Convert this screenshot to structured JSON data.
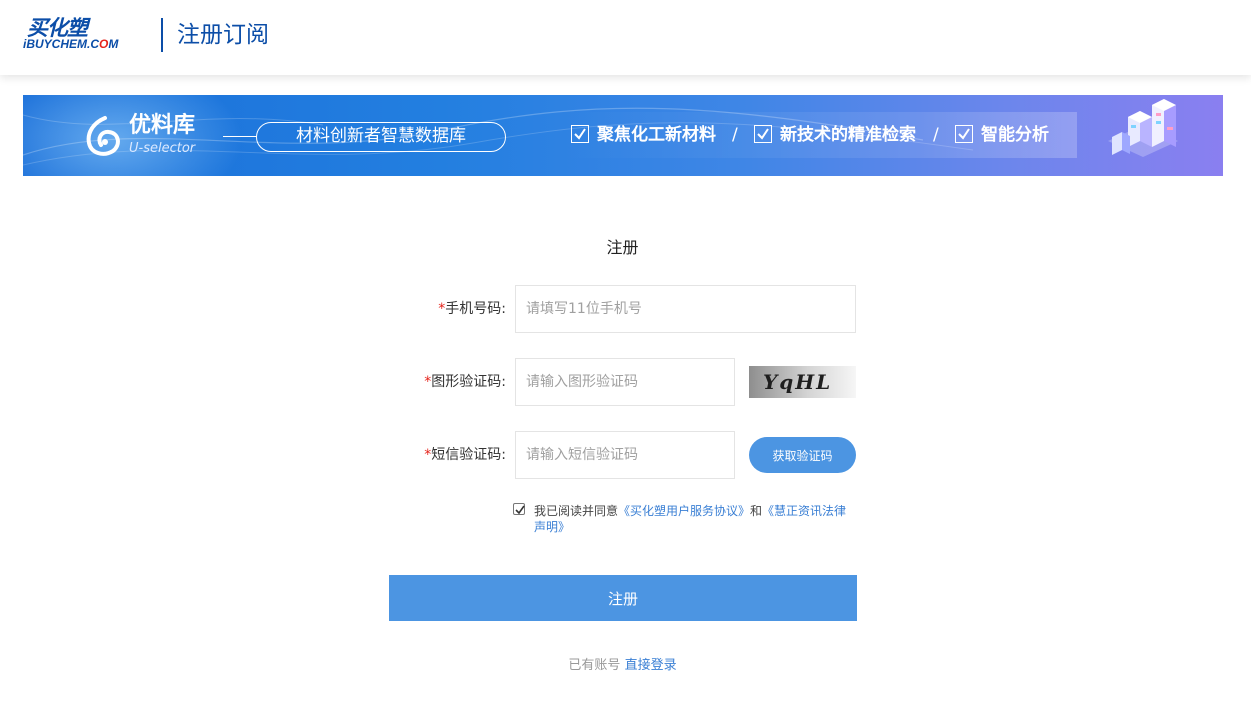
{
  "header": {
    "logo_cn": "买化塑",
    "logo_en_left": "iBUYCHEM.C",
    "logo_en_o": "O",
    "logo_en_right": "M",
    "title": "注册订阅"
  },
  "banner": {
    "brand_name": "优料库",
    "brand_sub": "U-selector",
    "tagline": "材料创新者智慧数据库",
    "features": [
      "聚焦化工新材料",
      "新技术的精准检索",
      "智能分析"
    ],
    "separator": "/"
  },
  "form": {
    "title": "注册",
    "required_mark": "*",
    "phone": {
      "label": "手机号码:",
      "placeholder": "请填写11位手机号",
      "value": ""
    },
    "image_code": {
      "label": "图形验证码:",
      "placeholder": "请输入图形验证码",
      "value": "",
      "captcha_text": "YqHL"
    },
    "sms_code": {
      "label": "短信验证码:",
      "placeholder": "请输入短信验证码",
      "value": "",
      "button": "获取验证码"
    },
    "agreement": {
      "checked": true,
      "prefix": "我已阅读并同意",
      "link1": "《买化塑用户服务协议》",
      "and": "和",
      "link2": "《慧正资讯法律声明》"
    },
    "submit": "注册",
    "login_prompt": "已有账号",
    "login_link": "直接登录"
  },
  "colors": {
    "brand_blue": "#0c4ea8",
    "button_blue": "#4c95e2",
    "link_blue": "#3a7fd4",
    "required_red": "#e5231b"
  }
}
